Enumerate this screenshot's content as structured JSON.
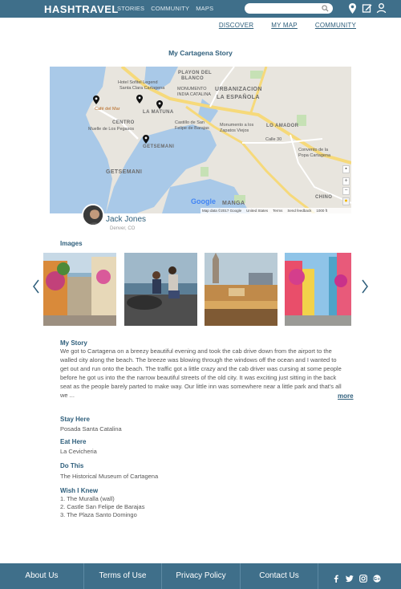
{
  "header": {
    "brand": "HASHTRAVEL",
    "nav": [
      "STORIES",
      "COMMUNITY",
      "MAPS"
    ],
    "search_placeholder": ""
  },
  "subnav": [
    "DISCOVER",
    "MY MAP",
    "COMMUNITY"
  ],
  "page": {
    "title": "My Cartagena Story"
  },
  "map": {
    "labels": {
      "playon": "PLAYON DEL",
      "blanco": "BLANCO",
      "urbanizacion": "URBANIZACION",
      "espanola": "LA ESPAÑOLA",
      "sofitel1": "Hotel Sofitel Legend",
      "sofitel2": "Santa Clara Cartagena",
      "monumento1": "MONUMENTO",
      "monumento2": "INDIA CATALINA",
      "cafe": "Café del Mar",
      "matuna": "LA MATUNA",
      "centro": "CENTRO",
      "muelle": "Muelle de Los Pegasos",
      "castillo1": "Castillo de San",
      "castillo2": "Felipe de Barajas",
      "zapatos1": "Monumento a los",
      "zapatos2": "Zapatos Viejos",
      "amador": "LO AMADOR",
      "getsemani_pin": "GETSEMANI",
      "getsemani": "GETSEMANI",
      "manga": "MANGA",
      "chino": "CHINO",
      "convento1": "Convento de la",
      "convento2": "Popa Cartagena",
      "calle30": "Calle 30"
    },
    "zoom_in": "+",
    "zoom_out": "−",
    "google": "Google",
    "footer": [
      "Map data ©2017 Google",
      "United States",
      "Terms",
      "Send feedback",
      "1000 ft"
    ]
  },
  "author": {
    "name": "Jack Jones",
    "location": "Denver, CO"
  },
  "images": {
    "title": "Images",
    "items": [
      "street-flowers-photo",
      "friends-on-wall-photo",
      "old-city-sunset-photo",
      "colorful-street-photo"
    ]
  },
  "story": {
    "title": "My Story",
    "text": "We got to Cartagena on a breezy beautiful evening and took the cab drive down from the airport to the walled city along the beach. The breeze was blowing through the windows off the ocean and I wanted to get out and run onto the beach. The traffic got a little crazy and the cab driver was cursing at some people before he got us into the the narrow beautiful streets of the old city. It was exciting just sitting in the back seat as the people barely parted to make way. Our little inn was somewhere near a little park and that's all we ...",
    "more": "more"
  },
  "stay": {
    "title": "Stay Here",
    "value": "Posada Santa Catalina"
  },
  "eat": {
    "title": "Eat Here",
    "value": "La Cevicheria"
  },
  "do": {
    "title": "Do This",
    "value": "The Historical Museum of Cartagena"
  },
  "wish": {
    "title": "Wish I Knew",
    "items": [
      "1. The Muralla (wall)",
      "2. Castle San Felipe de Barajas",
      "3. The Plaza Santo Domingo"
    ]
  },
  "footer": {
    "links": [
      "About Us",
      "Terms of Use",
      "Privacy Policy",
      "Contact Us"
    ],
    "social": [
      "facebook-icon",
      "twitter-icon",
      "instagram-icon",
      "google-plus-icon"
    ]
  },
  "colors": {
    "primary": "#3f6f8a",
    "link": "#2f5f7c"
  }
}
